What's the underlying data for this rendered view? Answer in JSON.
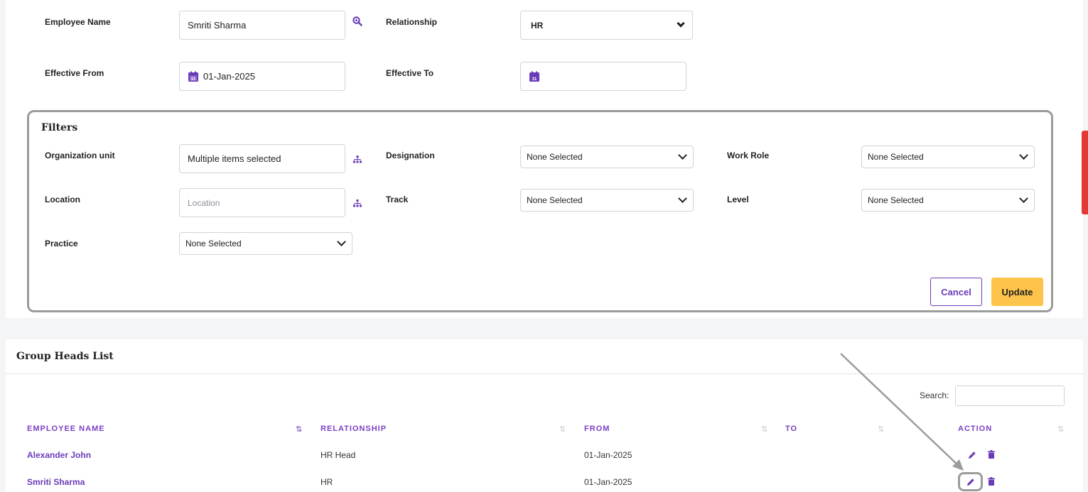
{
  "form": {
    "employee_name_label": "Employee Name",
    "employee_name_value": "Smriti Sharma",
    "relationship_label": "Relationship",
    "relationship_value": "HR",
    "effective_from_label": "Effective From",
    "effective_from_value": "01-Jan-2025",
    "effective_to_label": "Effective To",
    "effective_to_value": ""
  },
  "filters": {
    "title": "Filters",
    "org_unit_label": "Organization unit",
    "org_unit_value": "Multiple items selected",
    "designation_label": "Designation",
    "designation_value": "None Selected",
    "work_role_label": "Work Role",
    "work_role_value": "None Selected",
    "location_label": "Location",
    "location_placeholder": "Location",
    "track_label": "Track",
    "track_value": "None Selected",
    "level_label": "Level",
    "level_value": "None Selected",
    "practice_label": "Practice",
    "practice_value": "None Selected",
    "cancel_label": "Cancel",
    "update_label": "Update"
  },
  "list": {
    "title": "Group Heads List",
    "search_label": "Search:",
    "search_value": "",
    "columns": [
      "EMPLOYEE NAME",
      "RELATIONSHIP",
      "FROM",
      "TO",
      "ACTION"
    ],
    "rows": [
      {
        "name": "Alexander John",
        "relationship": "HR Head",
        "from": "01-Jan-2025",
        "to": ""
      },
      {
        "name": "Smriti Sharma",
        "relationship": "HR",
        "from": "01-Jan-2025",
        "to": ""
      }
    ]
  },
  "colors": {
    "accent": "#6a3bb8",
    "update_button": "#fcc44a",
    "red_tab": "#e53935"
  }
}
